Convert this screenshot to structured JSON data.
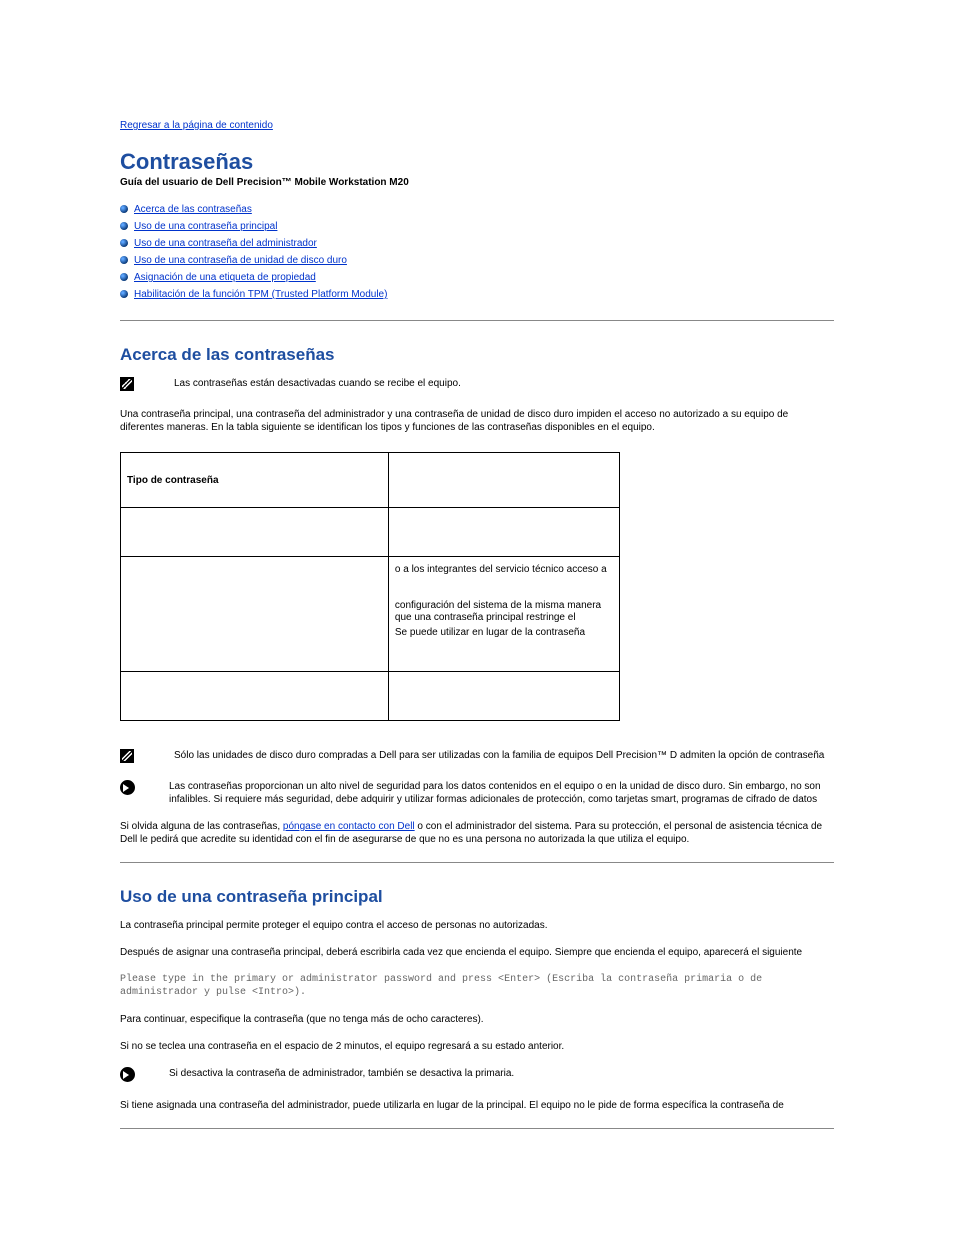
{
  "nav": {
    "back_link": "Regresar a la página de contenido"
  },
  "header": {
    "title": "Contraseñas",
    "subtitle": "Guía del usuario de Dell Precision™ Mobile Workstation M20"
  },
  "toc": [
    "Acerca de las contraseñas",
    "Uso de una contraseña principal",
    "Uso de una contraseña del administrador",
    "Uso de una contraseña de unidad de disco duro",
    "Asignación de una etiqueta de propiedad",
    "Habilitación de la función TPM (Trusted Platform Module)"
  ],
  "section1": {
    "heading": "Acerca de las contraseñas",
    "note1": "Las contraseñas están desactivadas cuando se recibe el equipo.",
    "para1": "Una contraseña principal, una contraseña del administrador y una contraseña de unidad de disco duro impiden el acceso no autorizado a su equipo de diferentes maneras. En la tabla siguiente se identifican los tipos y funciones de las contraseñas disponibles en el equipo.",
    "table": {
      "col1_header": "Tipo de contraseña",
      "col2_header": "",
      "rows": [
        {
          "type": "",
          "features": [
            ""
          ]
        },
        {
          "type": "",
          "features": [
            "o a los integrantes del servicio técnico acceso a",
            "configuración del sistema de la misma manera que una contraseña principal restringe el",
            "Se puede utilizar en lugar de la contraseña"
          ]
        },
        {
          "type": "",
          "features": [
            ""
          ]
        }
      ]
    },
    "note2": "Sólo las unidades de disco duro compradas a Dell para ser utilizadas con la familia de equipos Dell Precision™ D admiten la opción de contraseña",
    "caution": "Las contraseñas proporcionan un alto nivel de seguridad para los datos contenidos en el equipo o en la unidad de disco duro. Sin embargo, no son infalibles. Si requiere más seguridad, debe adquirir y utilizar formas adicionales de protección, como tarjetas smart, programas de cifrado de datos",
    "para2_pre": "Si olvida alguna de las contraseñas, ",
    "para2_link": "póngase en contacto con Dell",
    "para2_post": " o con el administrador del sistema. Para su protección, el personal de asistencia técnica de Dell le pedirá que acredite su identidad con el fin de asegurarse de que no es una persona no autorizada la que utiliza el equipo."
  },
  "section2": {
    "heading": "Uso de una contraseña principal",
    "para1": "La contraseña principal permite proteger el equipo contra el acceso de personas no autorizadas.",
    "para2": "Después de asignar una contraseña principal, deberá escribirla cada vez que encienda el equipo. Siempre que encienda el equipo, aparecerá el siguiente",
    "mono": "Please type in the primary or administrator password and press <Enter> (Escriba la contraseña primaria o de administrador y pulse <Intro>).",
    "para3": "Para continuar, especifique la contraseña (que no tenga más de ocho caracteres).",
    "para4": "Si no se teclea una contraseña en el espacio de 2 minutos, el equipo regresará a su estado anterior.",
    "caution": "Si desactiva la contraseña de administrador, también se desactiva la primaria.",
    "para5": "Si tiene asignada una contraseña del administrador, puede utilizarla en lugar de la principal. El equipo no le pide de forma específica la contraseña de"
  }
}
